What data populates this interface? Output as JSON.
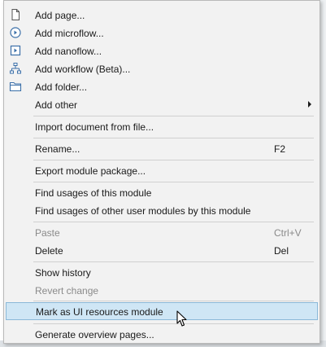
{
  "menu": {
    "items": [
      {
        "label": "Add page...",
        "icon": "page-icon",
        "shortcut": ""
      },
      {
        "label": "Add microflow...",
        "icon": "microflow-icon",
        "shortcut": ""
      },
      {
        "label": "Add nanoflow...",
        "icon": "nanoflow-icon",
        "shortcut": ""
      },
      {
        "label": "Add workflow (Beta)...",
        "icon": "workflow-icon",
        "shortcut": ""
      },
      {
        "label": "Add folder...",
        "icon": "folder-icon",
        "shortcut": ""
      },
      {
        "label": "Add other",
        "icon": "",
        "shortcut": "",
        "submenu": true
      },
      {
        "label": "Import document from file...",
        "shortcut": ""
      },
      {
        "label": "Rename...",
        "shortcut": "F2"
      },
      {
        "label": "Export module package...",
        "shortcut": ""
      },
      {
        "label": "Find usages of this module",
        "shortcut": ""
      },
      {
        "label": "Find usages of other user modules by this module",
        "shortcut": ""
      },
      {
        "label": "Paste",
        "shortcut": "Ctrl+V",
        "disabled": true
      },
      {
        "label": "Delete",
        "shortcut": "Del"
      },
      {
        "label": "Show history",
        "shortcut": ""
      },
      {
        "label": "Revert change",
        "shortcut": "",
        "disabled": true
      },
      {
        "label": "Mark as UI resources module",
        "shortcut": "",
        "highlighted": true
      },
      {
        "label": "Generate overview pages...",
        "shortcut": ""
      }
    ]
  },
  "colors": {
    "menu_bg": "#f2f2f2",
    "highlight_bg": "#cfe6f5",
    "highlight_border": "#8ab8d8",
    "disabled_text": "#8a8a8a",
    "icon_blue": "#3b6fa8"
  }
}
